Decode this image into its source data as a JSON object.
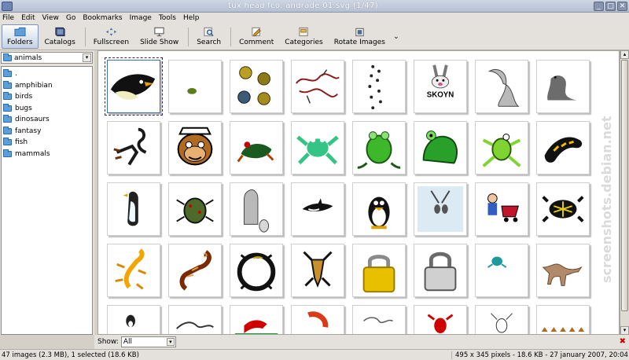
{
  "window": {
    "title": "tux head fco. andrade 01.svg (1/47)"
  },
  "menu": [
    "File",
    "Edit",
    "View",
    "Go",
    "Bookmarks",
    "Image",
    "Tools",
    "Help"
  ],
  "toolbar": {
    "folders": "Folders",
    "catalogs": "Catalogs",
    "fullscreen": "Fullscreen",
    "slideshow": "Slide Show",
    "search": "Search",
    "comment": "Comment",
    "categories": "Categories",
    "rotate": "Rotate Images"
  },
  "location": {
    "current": "animals"
  },
  "folders": [
    ".",
    "amphibian",
    "birds",
    "bugs",
    "dinosaurs",
    "fantasy",
    "fish",
    "mammals"
  ],
  "filter": {
    "label": "Show:",
    "value": "All"
  },
  "status": {
    "left": "47 images (2.3 MB), 1 selected (18.6 KB)",
    "right": "495 x 345 pixels - 18.6 KB - 27 january 2007, 20:04"
  },
  "thumbnail_texts": {
    "skoyn": "SKOYN"
  },
  "watermark": "screenshots.debian.net"
}
